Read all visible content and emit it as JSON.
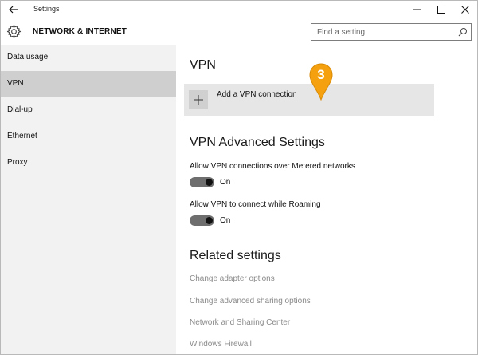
{
  "window": {
    "title": "Settings",
    "back_icon": "back-arrow-icon",
    "controls": [
      "minimize",
      "maximize",
      "close"
    ]
  },
  "header": {
    "icon": "gear-icon",
    "section_title": "NETWORK & INTERNET",
    "search_placeholder": "Find a setting"
  },
  "sidebar": {
    "items": [
      {
        "label": "Data usage",
        "active": false
      },
      {
        "label": "VPN",
        "active": true
      },
      {
        "label": "Dial-up",
        "active": false
      },
      {
        "label": "Ethernet",
        "active": false
      },
      {
        "label": "Proxy",
        "active": false
      }
    ]
  },
  "main": {
    "vpn_heading": "VPN",
    "add_vpn_label": "Add a VPN connection",
    "callout_number": "3",
    "callout_color": "#f5a00f",
    "advanced_heading": "VPN Advanced Settings",
    "settings": [
      {
        "label": "Allow VPN connections over Metered networks",
        "state": "On"
      },
      {
        "label": "Allow VPN to connect while Roaming",
        "state": "On"
      }
    ],
    "related_heading": "Related settings",
    "related_links": [
      "Change adapter options",
      "Change advanced sharing options",
      "Network and Sharing Center",
      "Windows Firewall"
    ]
  },
  "colors": {
    "sidebar_bg": "#f2f2f2",
    "active_item_bg": "#cfcfcf",
    "add_button_bg": "#e6e6e6",
    "link_gray": "#8a8a8a"
  }
}
